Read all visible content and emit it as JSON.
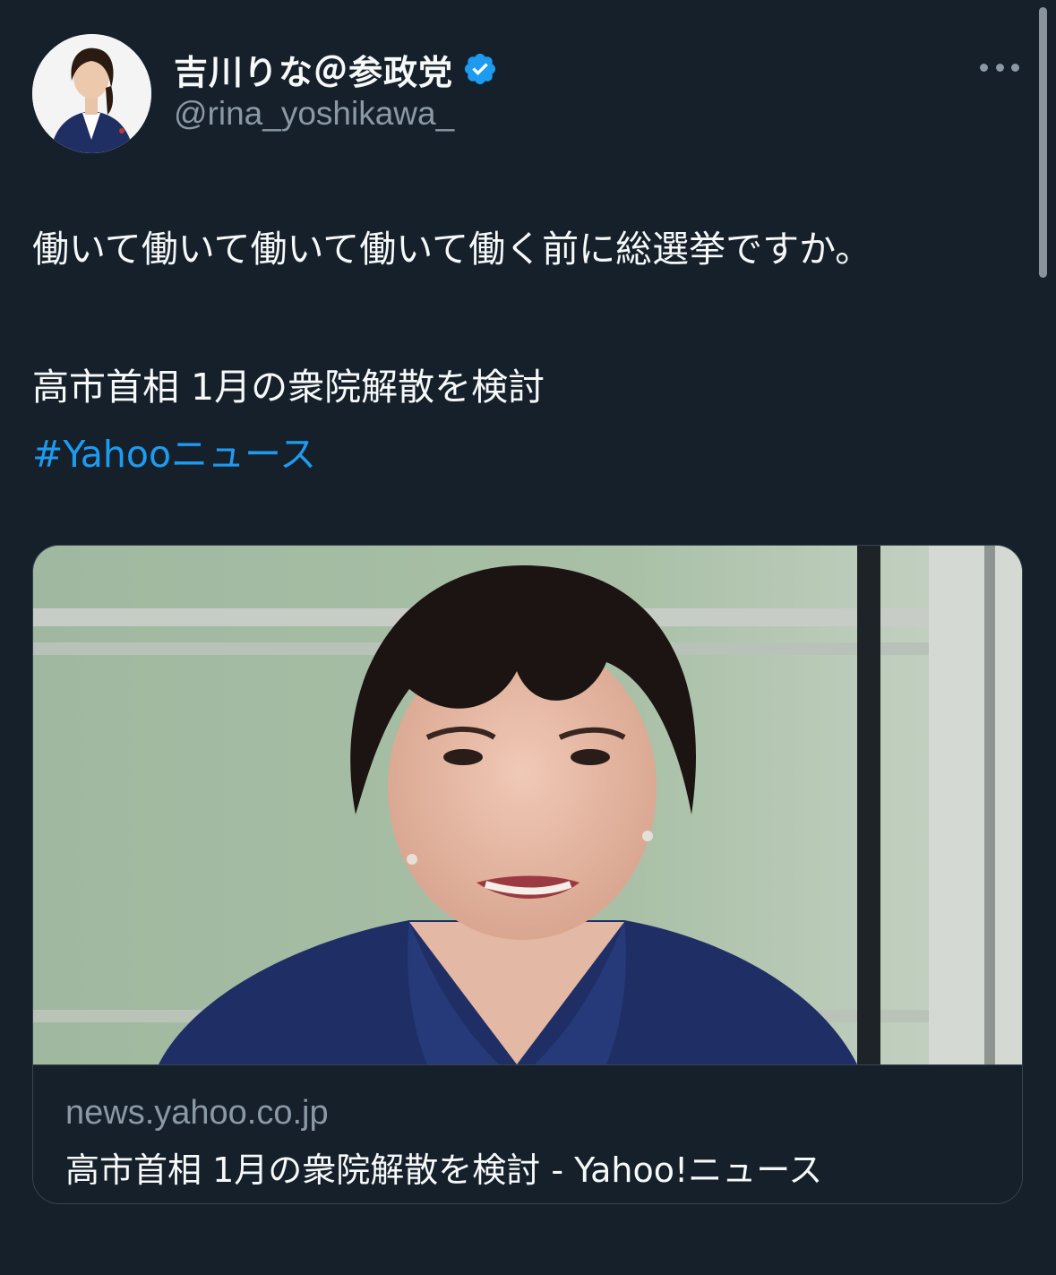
{
  "author": {
    "display_name": "吉川りな＠参政党",
    "handle": "@rina_yoshikawa_",
    "avatar_icon": "profile-photo",
    "verified_icon": "verified-badge-icon",
    "verified_color": "#1d9bf0"
  },
  "more_icon": "more-horizontal-icon",
  "tweet": {
    "line_1": "働いて働いて働いて働いて働く前に総選挙ですか。",
    "line_2": "高市首相 1月の衆院解散を検討",
    "hashtag": "#Yahooニュース",
    "hashtag_color": "#1d9bf0"
  },
  "card": {
    "image_alt": "news-photo",
    "domain": "news.yahoo.co.jp",
    "title": "高市首相 1月の衆院解散を検討 - Yahoo!ニュース"
  },
  "theme": {
    "background": "#15202b",
    "text": "#f7f9f9",
    "secondary_text": "#8b98a5",
    "border": "#38444d"
  }
}
